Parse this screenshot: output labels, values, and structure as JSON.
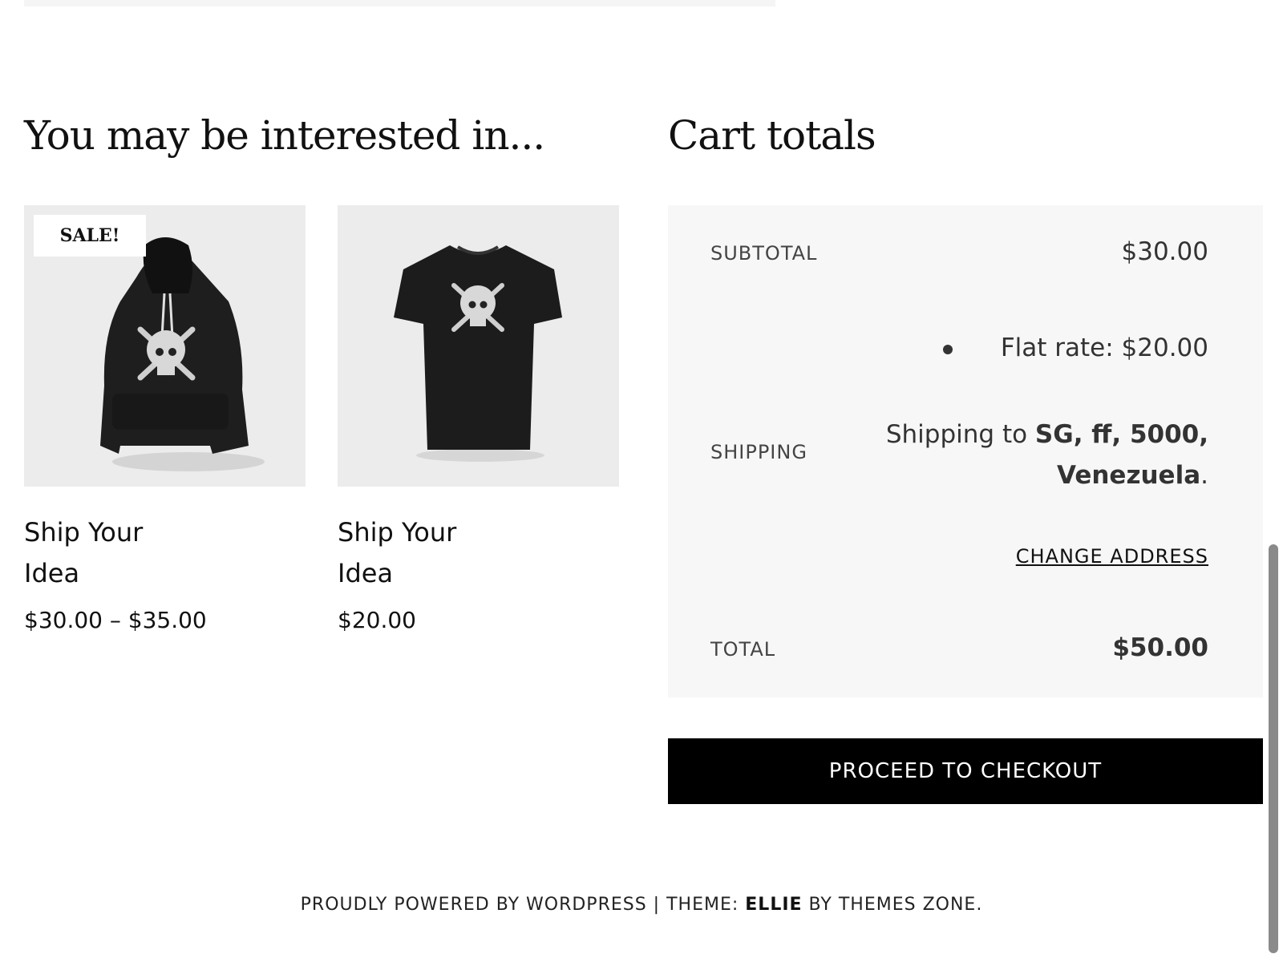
{
  "related": {
    "title": "You may be interested in...",
    "products": [
      {
        "name": "Ship Your Idea",
        "price": "$30.00 – $35.00",
        "badge": "SALE!",
        "image_icon": "hoodie-icon"
      },
      {
        "name": "Ship Your Idea",
        "price": "$20.00",
        "badge": "",
        "image_icon": "tshirt-icon"
      }
    ]
  },
  "cart": {
    "title": "Cart totals",
    "subtotal_label": "SUBTOTAL",
    "subtotal_value": "$30.00",
    "shipping_label": "SHIPPING",
    "shipping_option": "Flat rate: $20.00",
    "shipping_to_prefix": "Shipping to ",
    "shipping_to_address": "SG, ff, 5000, Venezuela",
    "shipping_to_suffix": ".",
    "change_address": "CHANGE ADDRESS",
    "total_label": "TOTAL",
    "total_value": "$50.00",
    "checkout_button": "PROCEED TO CHECKOUT"
  },
  "footer": {
    "prefix": "PROUDLY POWERED BY WORDPRESS | THEME: ",
    "theme_name": "ELLIE",
    "suffix": " BY THEMES ZONE."
  },
  "colors": {
    "checkout_bg": "#000000",
    "panel_bg": "#f7f7f7",
    "product_bg": "#ececec"
  }
}
